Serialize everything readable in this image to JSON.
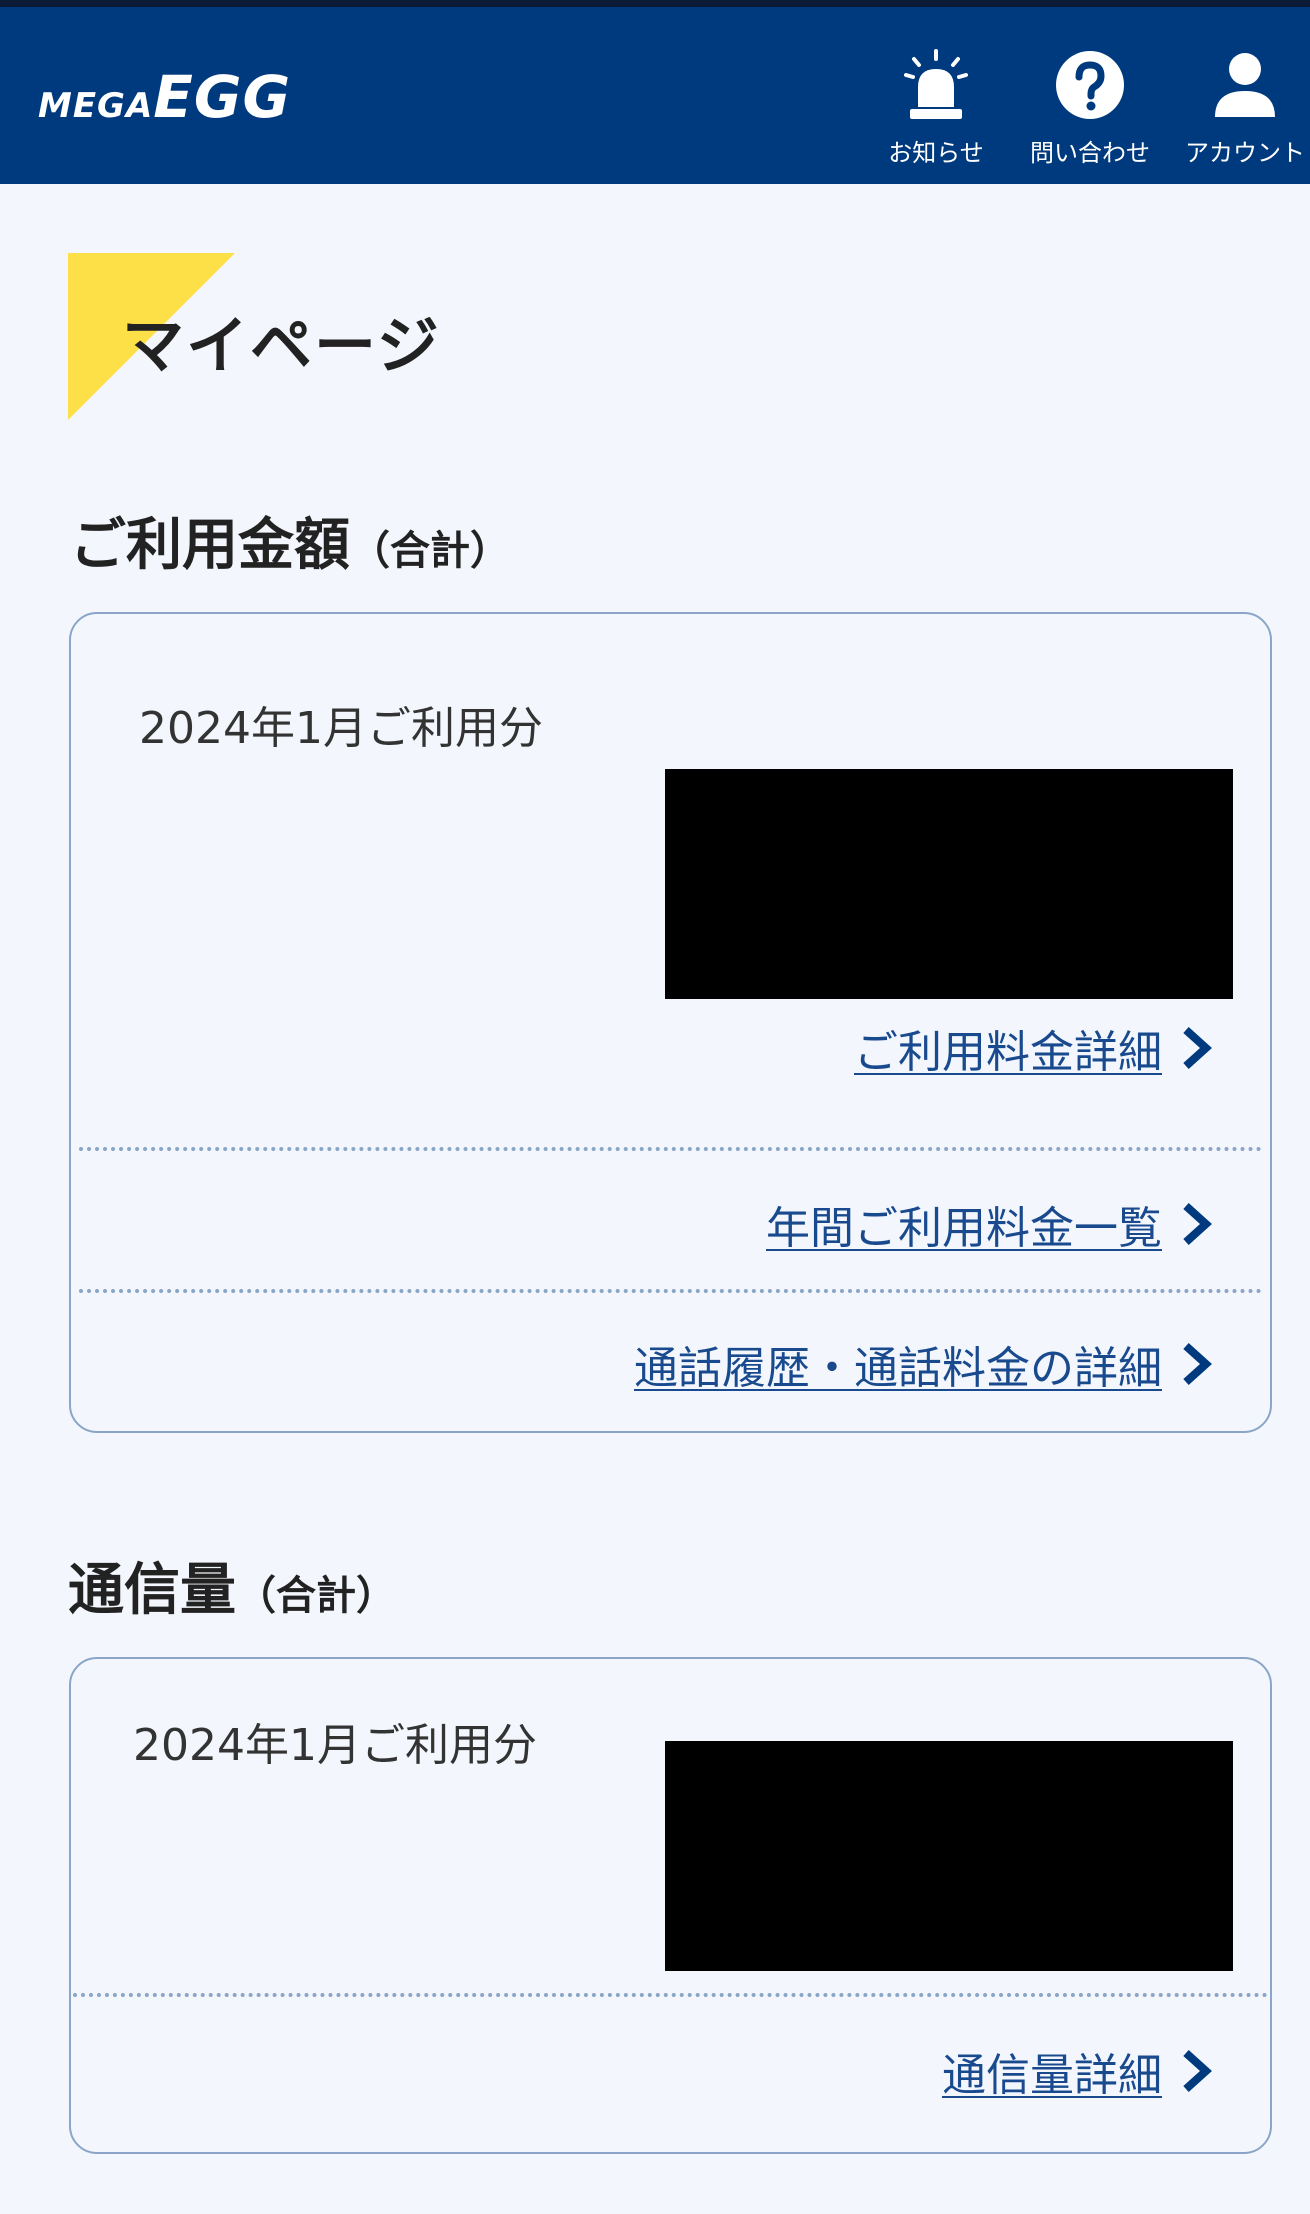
{
  "header": {
    "logo_prefix": "MEGA",
    "logo_main": "EGG",
    "nav": [
      {
        "label": "お知らせ",
        "icon": "siren-icon"
      },
      {
        "label": "問い合わせ",
        "icon": "help-question-icon"
      },
      {
        "label": "アカウント",
        "icon": "person-icon"
      }
    ]
  },
  "page": {
    "title": "マイページ"
  },
  "billing": {
    "heading": "ご利用金額",
    "heading_suffix": "（合計）",
    "period": "2024年1月ご利用分",
    "links": [
      "ご利用料金詳細",
      "年間ご利用料金一覧",
      "通話履歴・通話料金の詳細"
    ]
  },
  "traffic": {
    "heading": "通信量",
    "heading_suffix": "（合計）",
    "period": "2024年1月ご利用分",
    "link": "通信量詳細"
  },
  "colors": {
    "header_bg": "#003a7e",
    "page_bg": "#f3f7fd",
    "accent_yellow": "#fde047",
    "link": "#1a4a8e",
    "card_border": "#8aa5c7"
  }
}
